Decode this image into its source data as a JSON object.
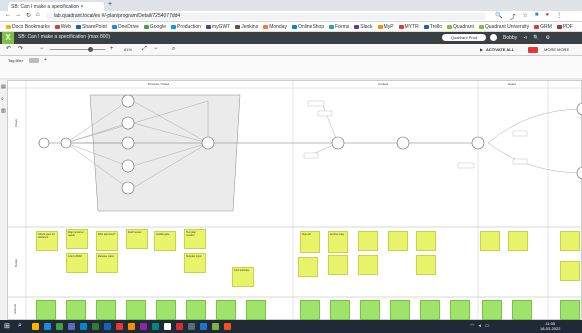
{
  "browser": {
    "tab_title": "SB: Can I make a specification ×",
    "url": "lab.quadrant.local/ex #/-plan/program/Detail/7254077dd4",
    "bookmarks": [
      {
        "label": "Docs Bookmarks",
        "color": "#f2b705"
      },
      {
        "label": "Web",
        "color": "#e53935"
      },
      {
        "label": "SharePoint",
        "color": "#1565c0"
      },
      {
        "label": "OneDrive",
        "color": "#1e88e5"
      },
      {
        "label": "Google",
        "color": "#43a047"
      },
      {
        "label": "Production",
        "color": "#039be5"
      },
      {
        "label": "myGWT",
        "color": "#3949ab"
      },
      {
        "label": "Jenkins",
        "color": "#6d4c41"
      },
      {
        "label": "Monday",
        "color": "#ff7043"
      },
      {
        "label": "OnlineShop",
        "color": "#0288d1"
      },
      {
        "label": "Forms",
        "color": "#26a69a"
      },
      {
        "label": "Slack",
        "color": "#5e35b1"
      },
      {
        "label": "MyP",
        "color": "#fb8c00"
      },
      {
        "label": "MYTR",
        "color": "#e53935"
      },
      {
        "label": "Trello",
        "color": "#1565c0"
      },
      {
        "label": "Quadrant",
        "color": "#7cc242"
      },
      {
        "label": "Quadrant University",
        "color": "#7cc242"
      },
      {
        "label": "GRM",
        "color": "#e53935"
      },
      {
        "label": "PDF",
        "color": "#c62828"
      }
    ]
  },
  "app": {
    "logo": "X",
    "title": "SB: Can I make a specification (max 800)",
    "accent": "#7cc242",
    "header_pill": "Quadrant Prod",
    "user": "Bobby"
  },
  "toolbar": {
    "zoom": "61%",
    "activate_label": "ACTIVATE ALL",
    "next_label": "MORE MORE"
  },
  "filter": {
    "label": "Tag filter"
  },
  "lanes": {
    "headers": [
      "Process / Flows",
      "Context",
      "Notes"
    ],
    "left_labels": [
      "Flows",
      "Notes",
      "Actions"
    ]
  },
  "colors": {
    "sticky": "#e8f56a",
    "sticky_action": "#9fe36a",
    "header_dark": "#3a3f44",
    "taskbar": "#1f2a36"
  },
  "notes": [
    "Check spec for tolerance",
    "Map customer needs",
    "Who approves?",
    "Draft review",
    "Quality gate",
    "Test plan needed",
    "Link to BOM",
    "Release notes",
    "Supplier input",
    "Cost estimate",
    "Sign-off",
    "Archive copy"
  ],
  "taskbar": {
    "time": "11:05",
    "date": "18-03-2022"
  }
}
